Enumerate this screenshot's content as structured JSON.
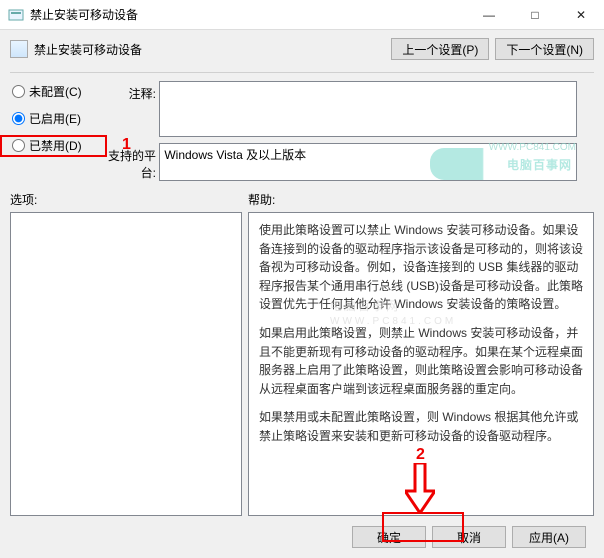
{
  "window": {
    "title": "禁止安装可移动设备",
    "minimize": "—",
    "maximize": "□",
    "close": "✕"
  },
  "header": {
    "title": "禁止安装可移动设备",
    "prev": "上一个设置(P)",
    "next": "下一个设置(N)"
  },
  "radios": {
    "not_configured": "未配置(C)",
    "enabled": "已启用(E)",
    "disabled": "已禁用(D)",
    "selected": "enabled"
  },
  "fields": {
    "annot_label": "注释:",
    "annot_value": "",
    "platform_label": "支持的平台:",
    "platform_value": "Windows Vista 及以上版本"
  },
  "labels": {
    "options": "选项:",
    "help": "帮助:"
  },
  "help": {
    "p1": "使用此策略设置可以禁止 Windows 安装可移动设备。如果设备连接到的设备的驱动程序指示该设备是可移动的，则将该设备视为可移动设备。例如，设备连接到的 USB 集线器的驱动程序报告某个通用串行总线 (USB)设备是可移动设备。此策略设置优先于任何其他允许 Windows 安装设备的策略设置。",
    "p2": "如果启用此策略设置，则禁止 Windows 安装可移动设备，并且不能更新现有可移动设备的驱动程序。如果在某个远程桌面服务器上启用了此策略设置，则此策略设置会影响可移动设备从远程桌面客户端到该远程桌面服务器的重定向。",
    "p3": "如果禁用或未配置此策略设置，则 Windows 根据其他允许或禁止策略设置来安装和更新可移动设备的设备驱动程序。"
  },
  "buttons": {
    "ok": "确定",
    "cancel": "取消",
    "apply": "应用(A)"
  },
  "annotations": {
    "num1": "1",
    "num2": "2"
  },
  "watermark": {
    "text": "电脑百事网",
    "url": "WWW.PC841.COM",
    "center": "电脑百事网",
    "center_url": "WWW.PC841.COM"
  }
}
